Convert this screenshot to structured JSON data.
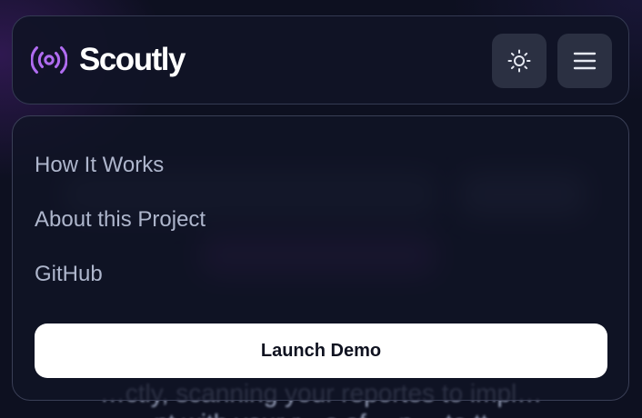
{
  "app": {
    "name": "Scoutly",
    "logo_icon": "broadcast-radio-icon",
    "accent_color": "#b06cf0"
  },
  "header": {
    "theme_toggle_icon": "sun-icon",
    "menu_icon": "hamburger-menu-icon",
    "button_color": "#2b3042"
  },
  "menu": {
    "items": [
      {
        "label": "How It Works"
      },
      {
        "label": "About this Project"
      },
      {
        "label": "GitHub"
      }
    ],
    "cta_label": "Launch Demo"
  },
  "background": {
    "line1": "…ctly, scanning your reportes to impl…",
    "line2": "…nt with your r…s of …p… to tt…"
  }
}
